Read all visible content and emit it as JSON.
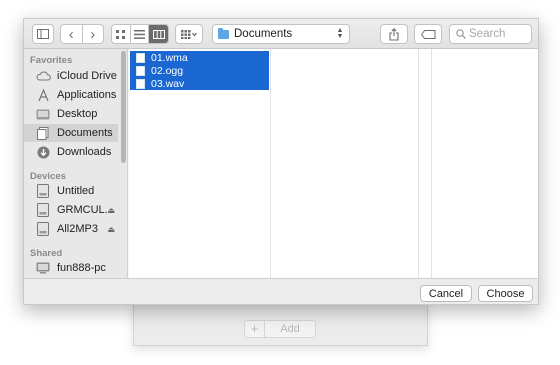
{
  "toolbar": {
    "path_label": "Documents",
    "search_placeholder": "Search"
  },
  "sidebar": {
    "favorites_title": "Favorites",
    "favorites": [
      {
        "label": "iCloud Drive",
        "icon": "cloud-icon"
      },
      {
        "label": "Applications",
        "icon": "applications-icon"
      },
      {
        "label": "Desktop",
        "icon": "desktop-icon"
      },
      {
        "label": "Documents",
        "icon": "documents-icon",
        "selected": true
      },
      {
        "label": "Downloads",
        "icon": "downloads-icon"
      }
    ],
    "devices_title": "Devices",
    "devices": [
      {
        "label": "Untitled",
        "icon": "disk-icon"
      },
      {
        "label": "GRMCUL...",
        "icon": "disk-icon",
        "eject": true
      },
      {
        "label": "All2MP3",
        "icon": "disk-icon",
        "eject": true
      }
    ],
    "shared_title": "Shared",
    "shared": [
      {
        "label": "fun888-pc",
        "icon": "computer-icon"
      }
    ]
  },
  "files": [
    "01.wma",
    "02.ogg",
    "03.wav"
  ],
  "buttons": {
    "cancel": "Cancel",
    "choose": "Choose"
  },
  "back_window": {
    "add_plus": "+",
    "add_label": "Add"
  },
  "glyphs": {
    "back": "‹",
    "forward": "›",
    "eject": "⏏",
    "grip": "||"
  }
}
